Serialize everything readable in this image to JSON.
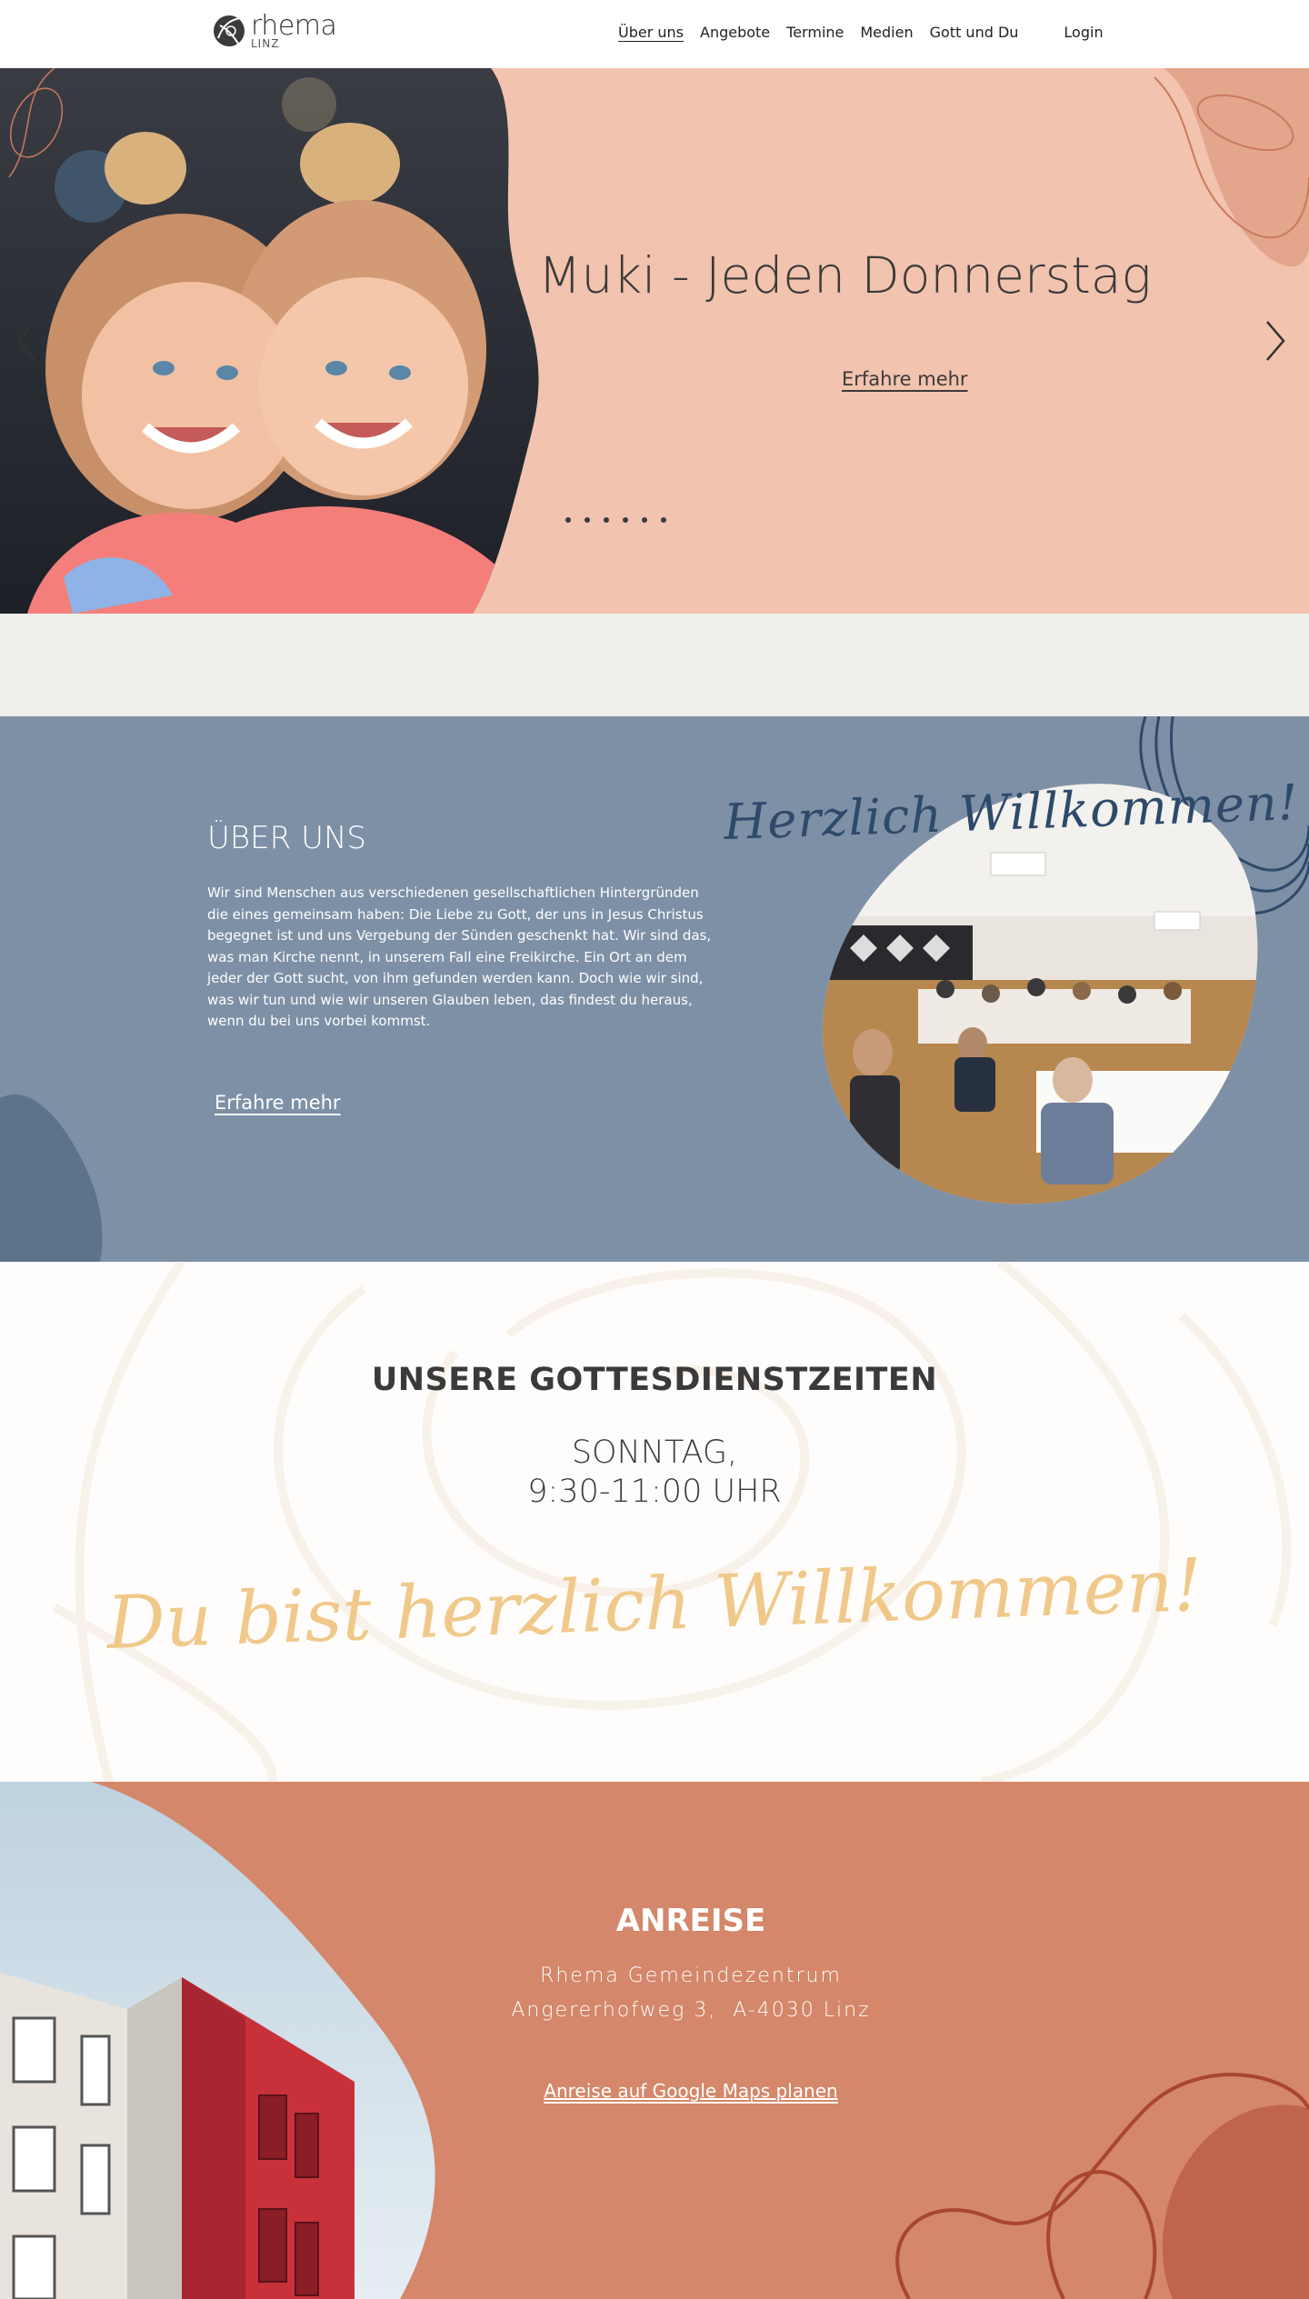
{
  "header": {
    "logo": {
      "name": "rhema",
      "city": "LINZ"
    },
    "nav": [
      {
        "label": "Über uns",
        "active": true
      },
      {
        "label": "Angebote"
      },
      {
        "label": "Termine"
      },
      {
        "label": "Medien"
      },
      {
        "label": "Gott und Du"
      },
      {
        "label": "Login"
      }
    ]
  },
  "hero": {
    "title": "Muki - Jeden Donnerstag",
    "link_label": "Erfahre mehr",
    "prev_icon": "chevron-left-icon",
    "next_icon": "chevron-right-icon",
    "slide_count": 6,
    "background_color": "#f2c3ae"
  },
  "about": {
    "heading": "ÜBER UNS",
    "text": "Wir sind Menschen aus verschiedenen gesellschaftlichen Hintergründen die eines gemeinsam haben: Die Liebe zu Gott, der uns in Jesus Christus begegnet ist und uns Vergebung der Sünden geschenkt hat. Wir sind das, was man Kirche nennt, in unserem Fall eine Freikirche. Ein Ort an dem jeder der Gott sucht, von ihm gefunden werden kann. Doch wie wir sind, was wir tun und wie wir unseren Glauben leben, das findest du heraus, wenn du bei uns vorbei kommst.",
    "link_label": "Erfahre mehr",
    "script_text": "Herzlich Willkommen!",
    "background_color": "#7e90a6"
  },
  "services": {
    "heading": "UNSERE GOTTESDIENSTZEITEN",
    "day": "SONNTAG,",
    "time": "9:30-11:00 UHR",
    "script_text": "Du bist herzlich Willkommen!"
  },
  "directions": {
    "heading": "ANREISE",
    "line1": "Rhema Gemeindezentrum",
    "line2": "Angererhofweg 3,  A-4030 Linz",
    "link_label": "Anreise auf Google Maps planen",
    "background_color": "#d4876a"
  }
}
